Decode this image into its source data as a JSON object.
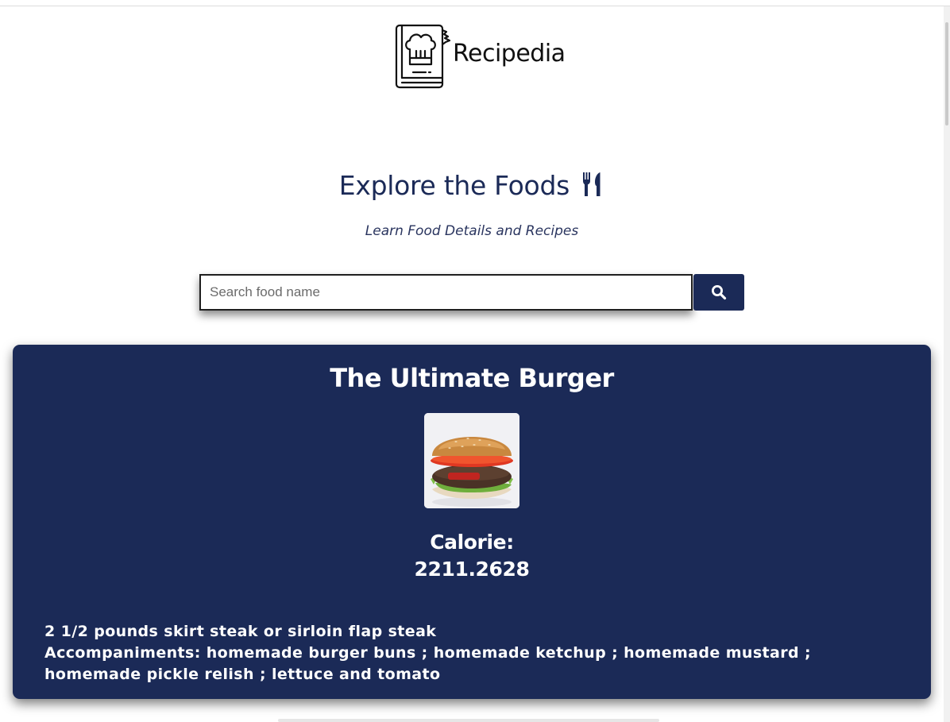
{
  "brand": {
    "name": "Recipedia"
  },
  "hero": {
    "heading": "Explore the Foods",
    "subtitle": "Learn Food Details and Recipes"
  },
  "search": {
    "placeholder": "Search food name",
    "value": ""
  },
  "food": {
    "title": "The Ultimate Burger",
    "calorie_label": "Calorie:",
    "calorie_value": "2211.2628",
    "ingredients": [
      "2 1/2 pounds skirt steak or sirloin flap steak",
      "Accompaniments: homemade burger buns ; homemade ketchup ; homemade mustard ; homemade pickle relish ; lettuce and tomato"
    ]
  },
  "icons": {
    "logo": "recipe-book-chef-hat-icon",
    "heading": "utensils-icon",
    "search": "search-icon"
  },
  "colors": {
    "primary": "#1b2a57",
    "card_text": "#ffffff"
  }
}
